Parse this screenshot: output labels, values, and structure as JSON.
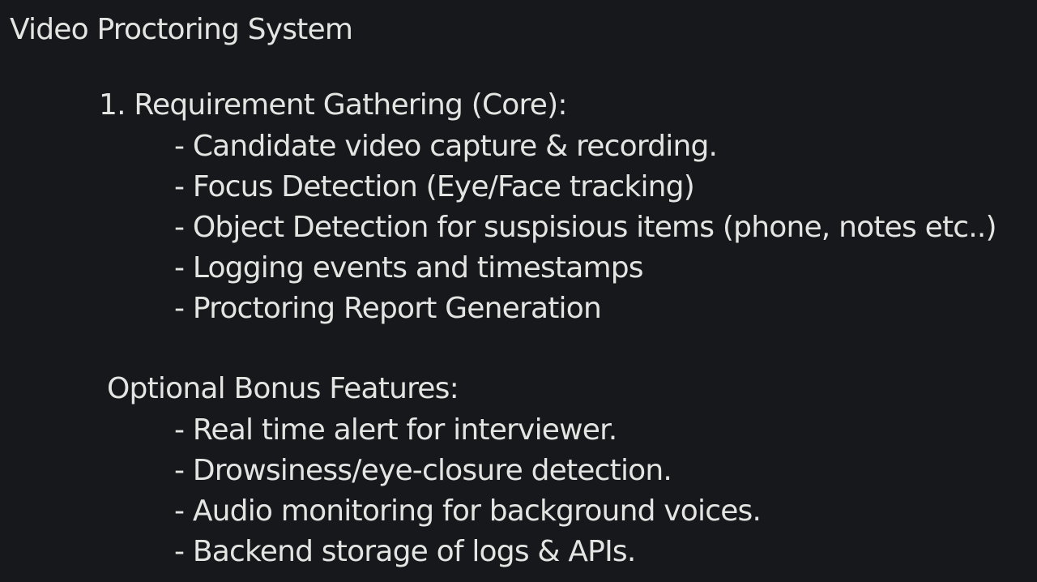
{
  "document": {
    "title": "Video Proctoring System"
  },
  "core_section": {
    "heading": "1. Requirement Gathering (Core):",
    "items": [
      "- Candidate video capture & recording.",
      "- Focus Detection (Eye/Face tracking)",
      "- Object Detection for suspisious items (phone, notes etc..)",
      "- Logging events and timestamps",
      "- Proctoring Report Generation"
    ]
  },
  "bonus_section": {
    "heading": "Optional Bonus Features:",
    "items": [
      "- Real time alert for interviewer.",
      "- Drowsiness/eye-closure detection.",
      "- Audio monitoring for background voices.",
      "- Backend storage of logs & APIs."
    ]
  },
  "colors": {
    "background": "#16181c",
    "text": "#e4e4e2"
  }
}
